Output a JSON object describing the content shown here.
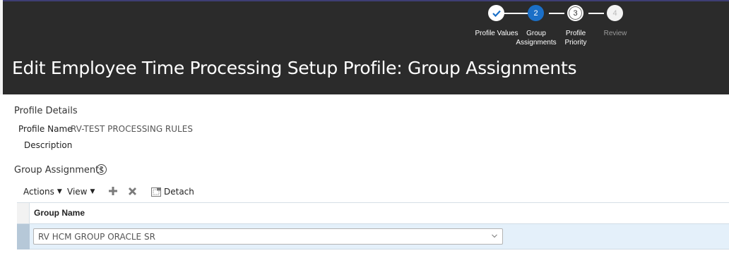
{
  "train": {
    "steps": [
      {
        "number": "",
        "label": "Profile Values",
        "state": "done"
      },
      {
        "number": "2",
        "label": "Group\nAssignments",
        "state": "current"
      },
      {
        "number": "3",
        "label": "Profile\nPriority",
        "state": "next"
      },
      {
        "number": "4",
        "label": "Review",
        "state": "disabled"
      }
    ]
  },
  "page": {
    "title": "Edit Employee Time Processing Setup Profile: Group Assignments"
  },
  "profile_details": {
    "section_title": "Profile Details",
    "name_label": "Profile Name",
    "name_value": "RV-TEST PROCESSING RULES",
    "description_label": "Description"
  },
  "group_assignments": {
    "section_title": "Group Assignments",
    "help_glyph": "?",
    "toolbar": {
      "actions_label": "Actions",
      "view_label": "View",
      "detach_label": "Detach"
    },
    "table": {
      "columns": [
        "Group Name"
      ],
      "rows": [
        {
          "group_name": "RV HCM GROUP ORACLE SR"
        }
      ]
    }
  },
  "colors": {
    "header_bg": "#2b2b2b",
    "current_step": "#1b6fc7",
    "selected_row": "#e4f0fa"
  },
  "icons": [
    "check-icon",
    "help-icon",
    "plus-icon",
    "close-icon",
    "detach-icon",
    "chevron-down-icon"
  ]
}
